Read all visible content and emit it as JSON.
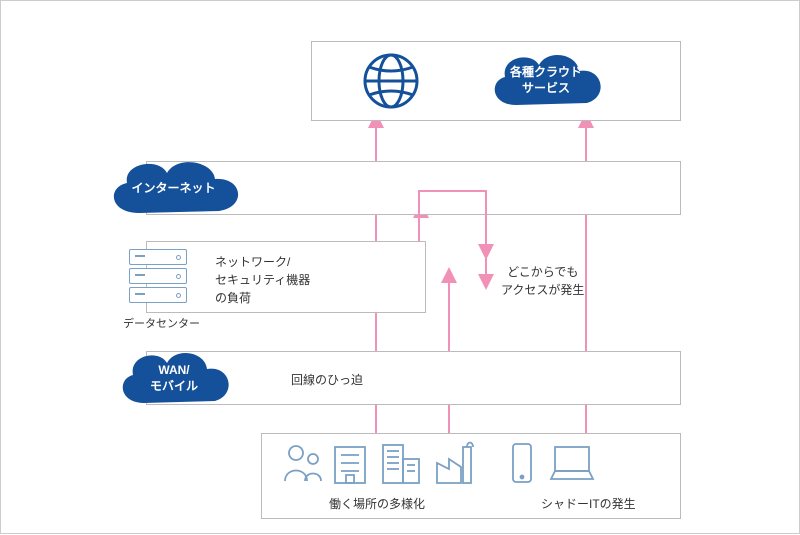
{
  "accent": "#14519a",
  "arrow": "#f191b7",
  "icon_stroke": "#7aa0c4",
  "clouds": {
    "services": "各種クラウド\nサービス",
    "internet": "インターネット",
    "wan": "WAN/\nモバイル"
  },
  "labels": {
    "datacenter": "データセンター",
    "network_load": "ネットワーク/\nセキュリティ機器\nの負荷",
    "line_strain": "回線のひっ迫",
    "access_anywhere": "どこからでも\nアクセスが発生",
    "workplace_diversity": "働く場所の多様化",
    "shadow_it": "シャドーITの発生"
  }
}
